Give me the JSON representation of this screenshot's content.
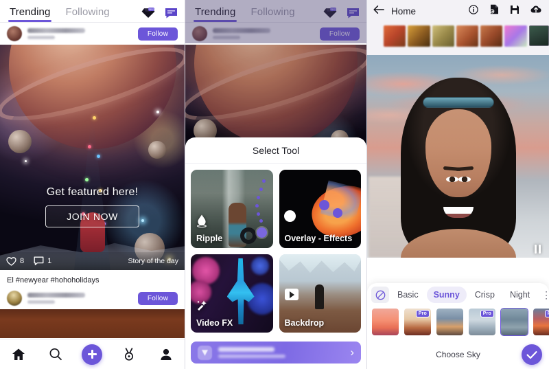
{
  "panel_feed": {
    "tabs": [
      {
        "label": "Trending",
        "active": true
      },
      {
        "label": "Following",
        "active": false
      }
    ],
    "pro_icon": "diamond-pro-icon",
    "pro_badge_text": "PRO",
    "message_icon": "chat-bubble-icon",
    "post_header": {
      "follow_label": "Follow",
      "avatar": "user-avatar"
    },
    "hero": {
      "title": "Get featured here!",
      "cta_label": "JOIN NOW",
      "likes": "8",
      "comments": "1",
      "story_tag": "Story of the day",
      "like_icon": "heart-icon",
      "comment_icon": "comment-icon"
    },
    "caption": "El  #newyear #hohoholidays",
    "post_footer": {
      "follow_label": "Follow"
    },
    "bottom_nav": [
      {
        "name": "home",
        "icon": "home-icon"
      },
      {
        "name": "search",
        "icon": "search-icon"
      },
      {
        "name": "create",
        "icon": "plus-icon"
      },
      {
        "name": "rewards",
        "icon": "medal-icon"
      },
      {
        "name": "profile",
        "icon": "person-icon"
      }
    ]
  },
  "panel_tools": {
    "tabs": [
      {
        "label": "Trending",
        "active": true
      },
      {
        "label": "Following",
        "active": false
      }
    ],
    "pro_icon": "diamond-pro-icon",
    "pro_badge_text": "PRO",
    "message_icon": "chat-bubble-icon",
    "post_header": {
      "follow_label": "Follow"
    },
    "sheet_title": "Select Tool",
    "tools": [
      {
        "label": "Ripple",
        "icon": "water-drop-icon"
      },
      {
        "label": "Overlay - Effects",
        "icon": "circle-overlay-icon"
      },
      {
        "label": "Video FX",
        "icon": "magic-wand-icon"
      },
      {
        "label": "Backdrop",
        "icon": "play-frame-icon"
      }
    ],
    "promo_banner": {
      "icon": "diamond-shield-icon",
      "line1": "",
      "line2": "",
      "chevron": "›"
    }
  },
  "panel_sky": {
    "back_icon": "back-arrow-icon",
    "title": "Home",
    "top_icons": [
      {
        "name": "info-icon"
      },
      {
        "name": "document-export-icon"
      },
      {
        "name": "save-icon"
      },
      {
        "name": "cloud-upload-icon"
      }
    ],
    "thumbnail_strip": [
      {
        "name": "thumb-1"
      },
      {
        "name": "thumb-2"
      },
      {
        "name": "thumb-3"
      },
      {
        "name": "thumb-4"
      },
      {
        "name": "thumb-5"
      },
      {
        "name": "thumb-6"
      },
      {
        "name": "thumb-7-selected"
      }
    ],
    "compare_icon": "pause-compare-icon",
    "categories": [
      {
        "label": "Basic",
        "active": false
      },
      {
        "label": "Sunny",
        "active": true
      },
      {
        "label": "Crisp",
        "active": false
      },
      {
        "label": "Night",
        "active": false
      }
    ],
    "none_icon": "no-sky-icon",
    "more_icon": "more-vertical-icon",
    "sky_thumbs": [
      {
        "id": "sk1",
        "pro": false,
        "selected": false
      },
      {
        "id": "sk2",
        "pro": true,
        "selected": false
      },
      {
        "id": "sk3",
        "pro": false,
        "selected": false
      },
      {
        "id": "sk4",
        "pro": true,
        "selected": false
      },
      {
        "id": "sk5",
        "pro": false,
        "selected": true
      },
      {
        "id": "sk6",
        "pro": true,
        "selected": false
      }
    ],
    "pro_label": "Pro",
    "choose_label": "Choose Sky",
    "confirm_icon": "check-icon"
  },
  "colors": {
    "accent_purple": "#6c56d9",
    "banner_purple": "#8a78e8",
    "panel_bg": "#f3f2f6"
  }
}
